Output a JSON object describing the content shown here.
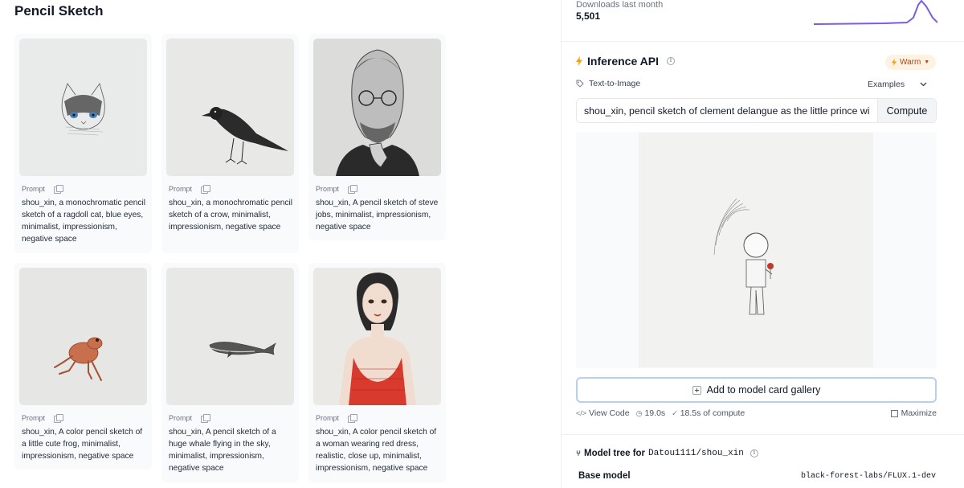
{
  "gallery": {
    "title": "Pencil Sketch",
    "prompt_label": "Prompt",
    "items": [
      {
        "text": "shou_xin, a monochromatic pencil sketch of a ragdoll cat, blue eyes, minimalist, impressionism, negative space"
      },
      {
        "text": "shou_xin, a monochromatic pencil sketch of a crow, minimalist, impressionism, negative space"
      },
      {
        "text": "shou_xin, A pencil sketch of steve jobs, minimalist, impressionism, negative space"
      },
      {
        "text": "shou_xin, A color pencil sketch of a little cute frog, minimalist, impressionism, negative space"
      },
      {
        "text": "shou_xin, A pencil sketch of a huge whale flying in the sky, minimalist, impressionism, negative space"
      },
      {
        "text": "shou_xin, A color pencil sketch of a woman wearing red dress, realistic, close up, minimalist, impressionism, negative space"
      }
    ]
  },
  "downloads": {
    "label": "Downloads last month",
    "count": "5,501"
  },
  "inference": {
    "title": "Inference API",
    "status": "Warm",
    "task": "Text-to-Image",
    "examples_label": "Examples",
    "input_value": "shou_xin, pencil sketch of clement delangue as the little prince with hi",
    "compute_label": "Compute",
    "add_gallery_label": "Add to model card gallery",
    "view_code_label": "View Code",
    "time": "19.0s",
    "compute_time": "18.5s of compute",
    "maximize_label": "Maximize"
  },
  "model_tree": {
    "title": "Model tree for",
    "repo": "Datou1111/shou_xin",
    "base_label": "Base model",
    "base_value": "black-forest-labs/FLUX.1-dev"
  },
  "colors": {
    "accent": "#7c5ce5",
    "warm_text": "#c2410c",
    "warm_bg": "#fef3e2",
    "focus_border": "#b7cff0"
  }
}
